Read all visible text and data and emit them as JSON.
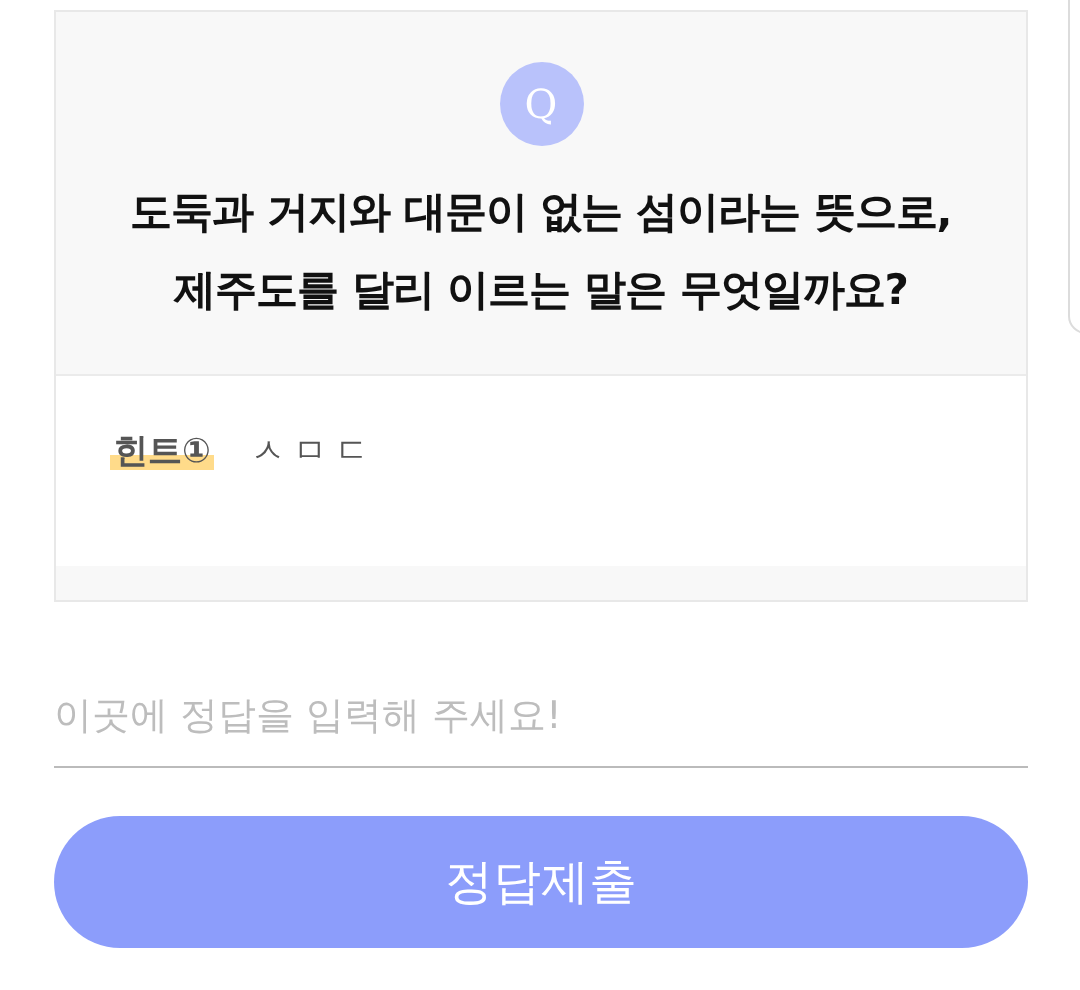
{
  "question": {
    "badge": "Q",
    "lines": [
      "도둑과 거지와 대문이 없는 섬이라는 뜻으로,",
      "제주도를 달리 이르는 말은 무엇일까요?"
    ]
  },
  "hints": [
    {
      "label": "힌트①",
      "text": "ㅅㅁㄷ"
    }
  ],
  "answer": {
    "placeholder": "이곳에 정답을 입력해 주세요!"
  },
  "submit": {
    "label": "정답제출"
  }
}
